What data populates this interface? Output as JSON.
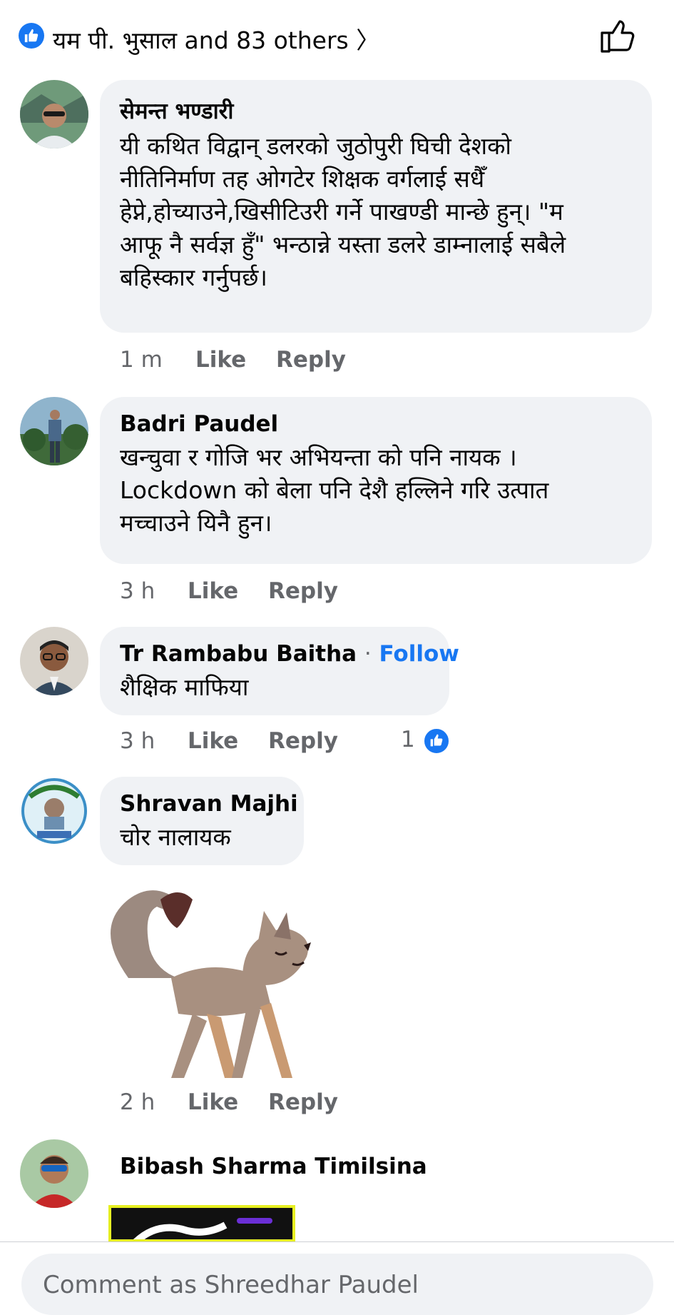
{
  "reactions": {
    "summary": "यम पी. भुसाल and 83 others",
    "chevron": "〉"
  },
  "comments": [
    {
      "author": "सेमन्त भण्डारी",
      "lines": [
        "यी कथित विद्वान् डलरको जुठोपुरी घिची देशको",
        "नीतिनिर्माण तह ओगटेर शिक्षक वर्गलाई सधैँ",
        "हेप्ने,होच्याउने,खिसीटिउरी गर्ने पाखण्डी मान्छे हुन्। \"म",
        "आफू नै सर्वज्ञ हुँ\" भन्ठान्ने यस्ता डलरे डाम्नालाई सबैले",
        "बहिस्कार गर्नुपर्छ।"
      ],
      "time": "1 m",
      "like": "Like",
      "reply": "Reply"
    },
    {
      "author": "Badri Paudel",
      "lines": [
        "खन्चुवा र गोजि भर अभियन्ता को पनि नायक ।",
        "Lockdown को बेला पनि देशै हल्लिने गरि उत्पात",
        "मच्चाउने यिनै हुन।"
      ],
      "time": "3 h",
      "like": "Like",
      "reply": "Reply"
    },
    {
      "author": "Tr Rambabu Baitha",
      "separator": "·",
      "follow": "Follow",
      "lines": [
        "शैक्षिक माफिया"
      ],
      "time": "3 h",
      "like": "Like",
      "reply": "Reply",
      "reaction_count": "1"
    },
    {
      "author": "Shravan Majhi",
      "lines": [
        "चोर नालायक"
      ],
      "time": "2 h",
      "like": "Like",
      "reply": "Reply"
    },
    {
      "author": "Bibash Sharma Timilsina"
    }
  ],
  "composer": {
    "placeholder": "Comment as Shreedhar Paudel"
  },
  "colors": {
    "accent": "#1877f2",
    "bubble": "#f0f2f5",
    "meta": "#65676b"
  },
  "icons": {
    "reaction": "like-badge-icon",
    "post_like": "thumbs-up-outline-icon",
    "sticker": "walking-fox-sticker"
  }
}
